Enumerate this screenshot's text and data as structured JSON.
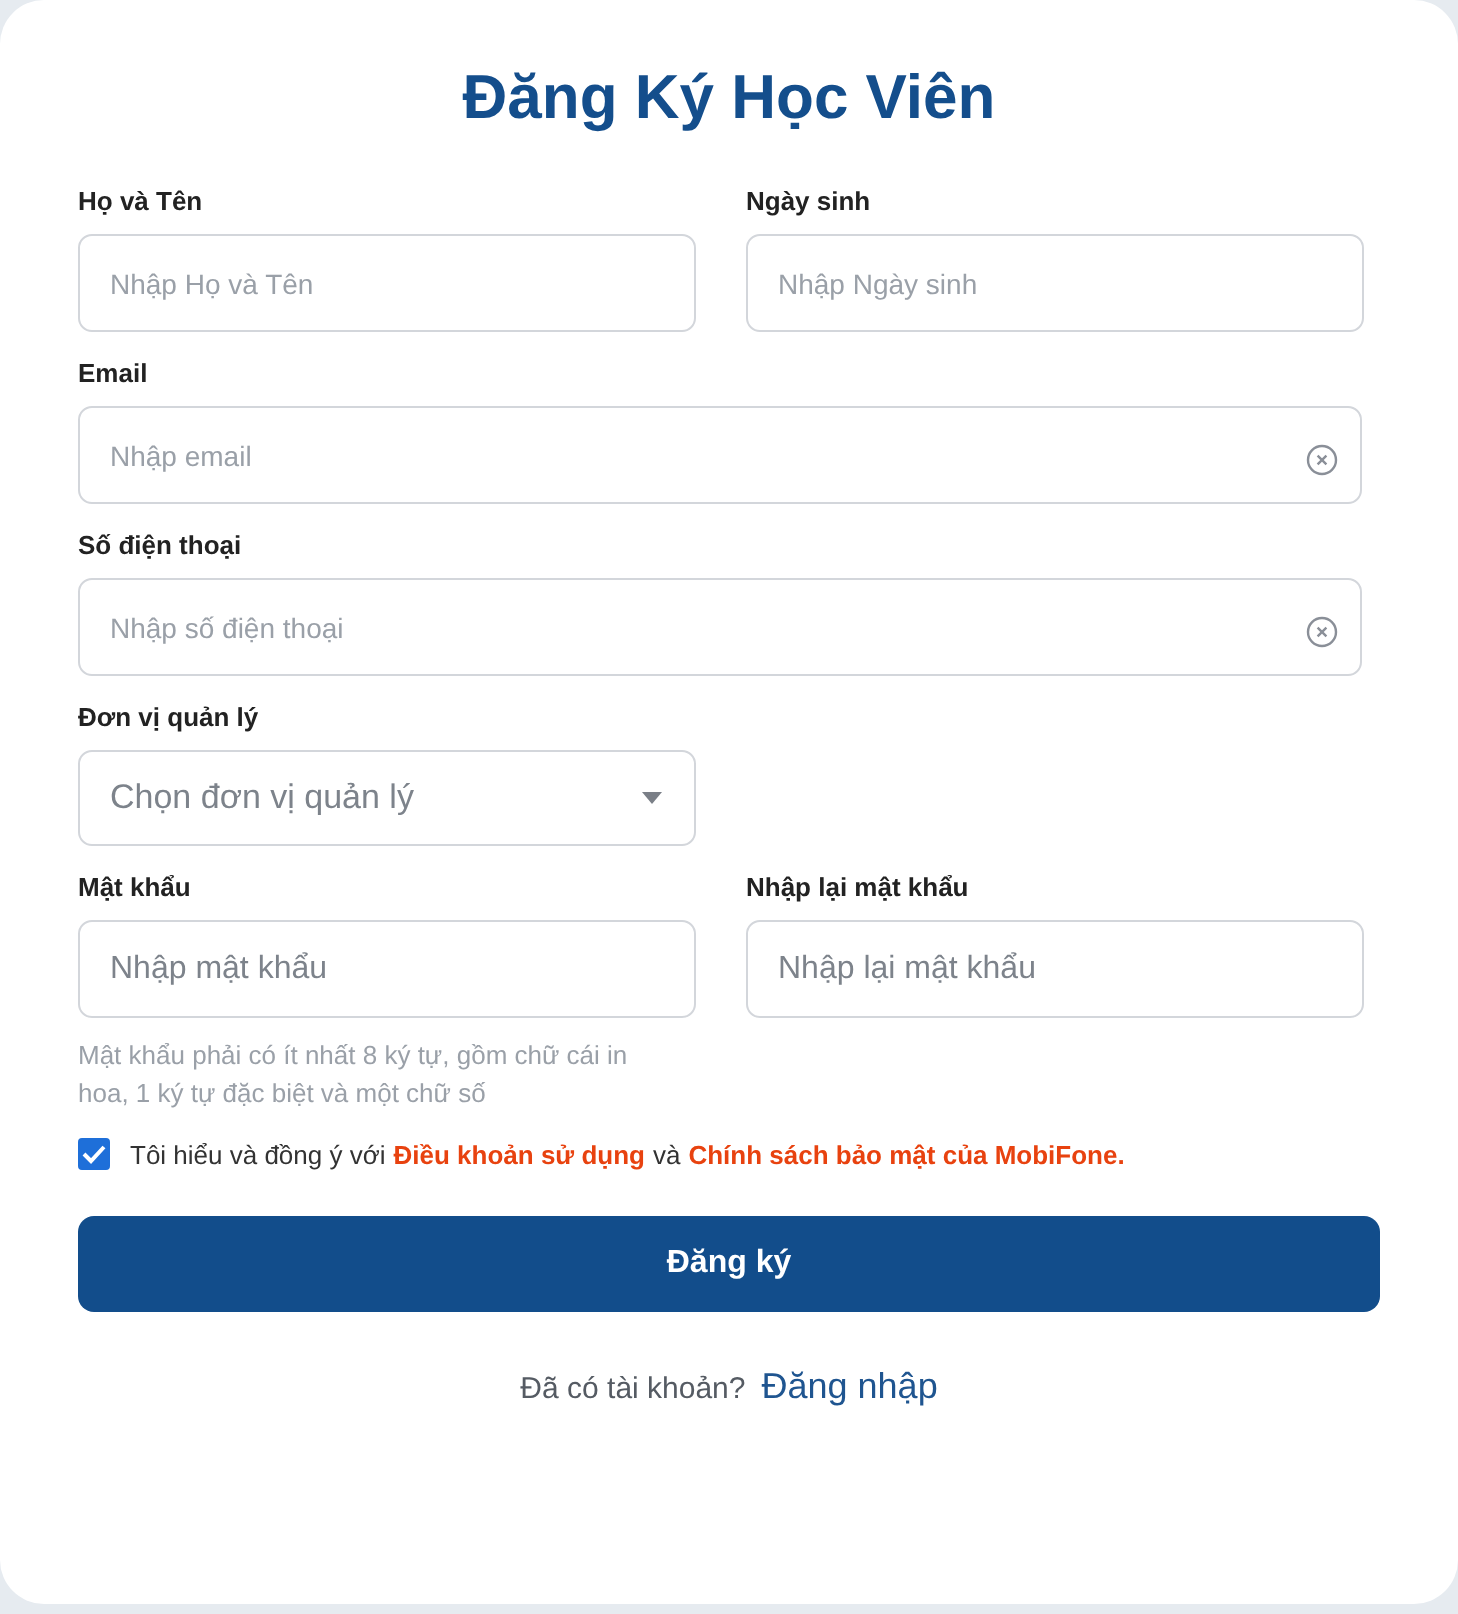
{
  "title": "Đăng Ký Học Viên",
  "rows": [
    {
      "fields": [
        {
          "label": "Họ và Tên",
          "placeholder": "Nhập Họ và Tên",
          "kind": "text"
        },
        {
          "label": "Ngày sinh",
          "placeholder": "Nhập Ngày sinh",
          "kind": "text"
        }
      ]
    },
    {
      "fields": [
        {
          "label": "Email",
          "placeholder": "Nhập email",
          "kind": "clearable"
        }
      ]
    },
    {
      "fields": [
        {
          "label": "Số điện thoại",
          "placeholder": "Nhập số điện thoại",
          "kind": "clearable"
        }
      ]
    },
    {
      "fields": [
        {
          "label": "Đơn vị quản lý",
          "placeholder": "Chọn đơn vị quản lý",
          "kind": "select"
        }
      ]
    },
    {
      "fields": [
        {
          "label": "Mật khẩu",
          "placeholder": "Nhập mật khẩu",
          "kind": "password",
          "hint": "Mật khẩu phải có ít nhất 8 ký tự, gồm chữ cái in hoa, 1 ký tự đặc biệt và một chữ số"
        },
        {
          "label": "Nhập lại mật khẩu",
          "placeholder": "Nhập lại mật khẩu",
          "kind": "password"
        }
      ]
    }
  ],
  "agreement": {
    "checked": true,
    "text": "Tôi hiểu và đồng ý với",
    "terms_link": "Điều khoản sử dụng",
    "conjunction": "và",
    "privacy_link": "Chính sách bảo mật của MobiFone."
  },
  "submit_button": "Đăng ký",
  "footer": {
    "text": "Đã có tài khoản?",
    "login_link": "Đăng nhập"
  }
}
